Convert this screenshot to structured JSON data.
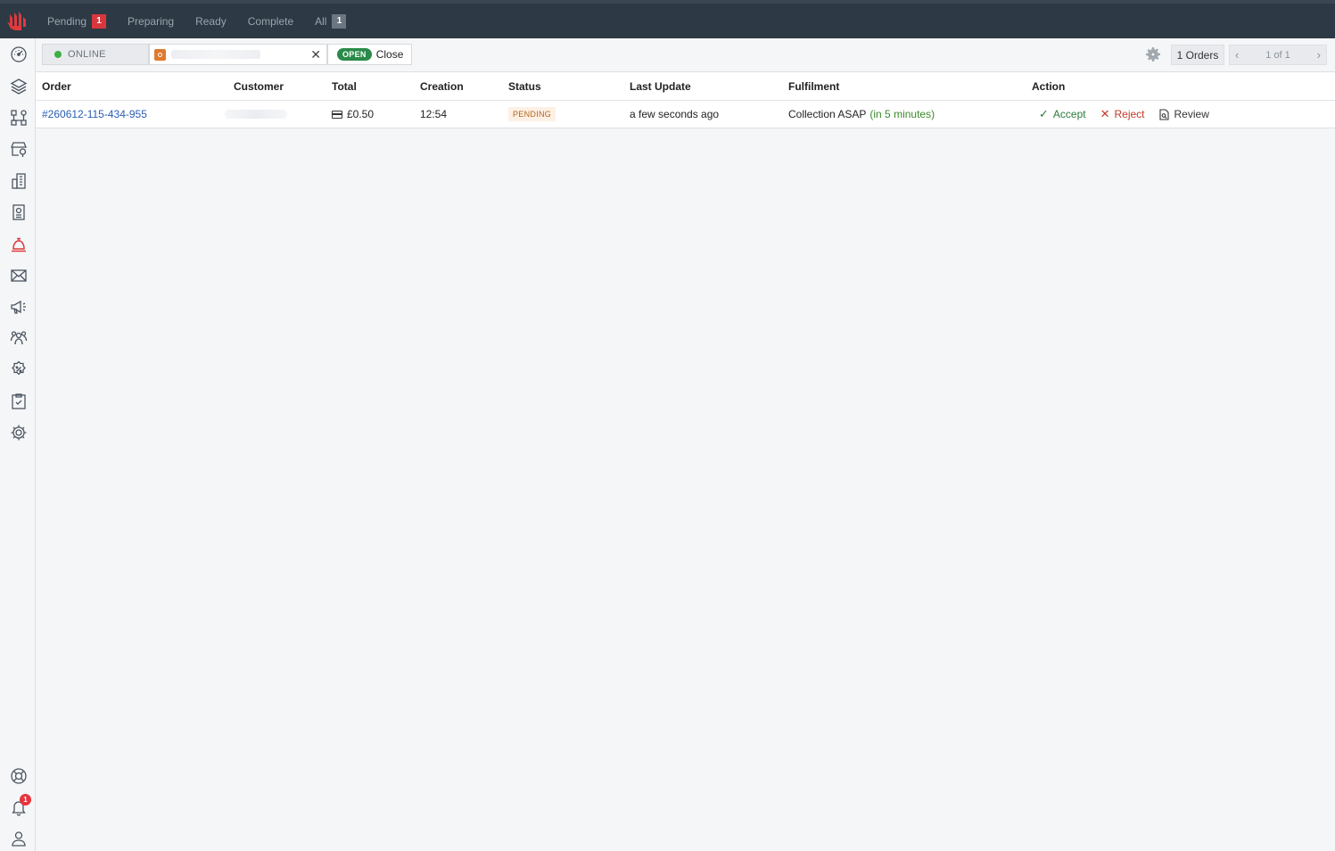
{
  "topbar": {
    "tabs": [
      {
        "label": "Pending",
        "count": "1"
      },
      {
        "label": "Preparing"
      },
      {
        "label": "Ready"
      },
      {
        "label": "Complete"
      },
      {
        "label": "All",
        "count": "1"
      }
    ]
  },
  "sidebar": {
    "icons": [
      "dashboard-icon",
      "layers-icon",
      "integrations-icon",
      "store-location-icon",
      "buildings-icon",
      "receipt-icon",
      "orders-bell-icon",
      "mail-icon",
      "megaphone-icon",
      "customers-icon",
      "discount-icon",
      "checklist-icon",
      "settings-icon",
      "help-icon",
      "notifications-icon",
      "profile-icon"
    ],
    "active_icon": "orders-bell-icon",
    "notification_count": "1"
  },
  "toolbar": {
    "online_label": "ONLINE",
    "open_label": "OPEN",
    "close_label": "Close",
    "clear_symbol": "✕",
    "orders_count": "1 Orders",
    "pager_text": "1 of 1"
  },
  "table": {
    "headers": [
      "Order",
      "Customer",
      "Total",
      "Creation",
      "Status",
      "Last Update",
      "Fulfilment",
      "Action"
    ],
    "rows": [
      {
        "order": "#260612-115-434-955",
        "total": "£0.50",
        "creation": "12:54",
        "status": "PENDING",
        "last_update": "a few seconds ago",
        "fulfilment": "Collection ASAP",
        "fulfilment_eta": "(in 5 minutes)",
        "actions": {
          "accept": "Accept",
          "reject": "Reject",
          "review": "Review"
        }
      }
    ]
  },
  "colors": {
    "topbar": "#2d3a45",
    "accent_red": "#d9363e",
    "online_green": "#3cb043",
    "open_green": "#2a8a4a",
    "link_blue": "#2a5db0"
  }
}
